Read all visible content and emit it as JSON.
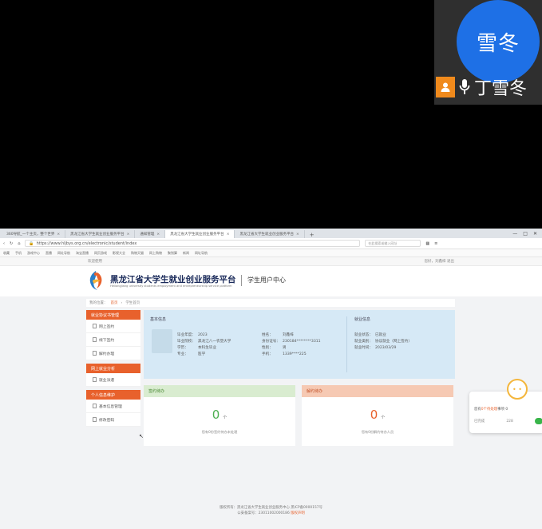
{
  "video_call": {
    "avatar_text": "雪冬",
    "participant_name": "丁雪冬",
    "colors": {
      "avatar": "#1e70e6",
      "person_badge": "#f08a1c"
    }
  },
  "browser": {
    "tabs": [
      {
        "label": "360导航_一个主页，整个世界",
        "active": false
      },
      {
        "label": "黑龙江省大学生就业创业服务平台",
        "active": false
      },
      {
        "label": "通知管理",
        "active": false
      },
      {
        "label": "黑龙江省大学生就业创业服务平台",
        "active": true
      },
      {
        "label": "黑龙江省大学生就业创业服务平台",
        "active": false
      }
    ],
    "tab_close_glyph": "×",
    "new_tab_glyph": "+",
    "url": "https://www.hljbys.org.cn/electronic/student/index",
    "search_placeholder": "在此搜索或输入网址",
    "bookmarks": [
      "收藏",
      "手机",
      "游戏中心",
      "直播",
      "网址导航",
      "淘宝直播",
      "网页游戏",
      "影视大全",
      "购物天猫",
      "网上购物",
      "聚划算",
      "新闻",
      "网址导航"
    ]
  },
  "site": {
    "topbar_left": "欢迎使用",
    "topbar_right": "您好，刘鑫梓 退出",
    "title": "黑龙江省大学生就业创业服务平台",
    "subtitle": "Heilongjiang university students employment and entrepreneurship service platform",
    "center": "学生用户中心",
    "breadcrumb": {
      "label": "我的位置：",
      "home": "首页",
      "current": "学生首页"
    }
  },
  "sidebar": {
    "groups": [
      {
        "title": "就业协议书管理",
        "items": [
          "网上签约",
          "线下签约",
          "解约办理"
        ]
      },
      {
        "title": "网上就业分析",
        "items": [
          "就业派遣"
        ]
      },
      {
        "title": "个人信息维护",
        "items": [
          "基本信息管理",
          "修改密码"
        ]
      }
    ]
  },
  "basic_info": {
    "title": "基本信息",
    "fields": [
      {
        "k": "毕业年度：",
        "v": "2023"
      },
      {
        "k": "毕业院校：",
        "v": "黑龙江八一农垦大学"
      },
      {
        "k": "学历：",
        "v": "本科生毕业"
      },
      {
        "k": "专业：",
        "v": "医学"
      },
      {
        "k": "姓名：",
        "v": "刘鑫梓"
      },
      {
        "k": "身份证号：",
        "v": "230184********3311"
      },
      {
        "k": "性别：",
        "v": "男"
      },
      {
        "k": "手机：",
        "v": "1339****225"
      }
    ]
  },
  "employment_info": {
    "title": "就业信息",
    "fields": [
      {
        "k": "就业状态：",
        "v": "已就业"
      },
      {
        "k": "就业类别：",
        "v": "协议就业（网上签约）"
      },
      {
        "k": "就业时间：",
        "v": "2023/03/29"
      }
    ]
  },
  "cards": [
    {
      "title": "签约待办",
      "count": "0",
      "unit": "个",
      "desc": "您有0份签约待办未处理"
    },
    {
      "title": "解约待办",
      "count": "0",
      "unit": "个",
      "desc": "您有0份解约待办人员"
    }
  ],
  "float_widget": {
    "face": "• •",
    "text_a": "您有",
    "text_hl": "0个待处理",
    "text_b": "事项",
    "count": "0",
    "label": "已完成",
    "right": "228"
  },
  "footer": {
    "line1": "版权所有：黑龙江省大学生就业创业服务中心 黑ICP备0000157号",
    "line2": "公安备案号：23011002000186",
    "link": "版权声明"
  }
}
